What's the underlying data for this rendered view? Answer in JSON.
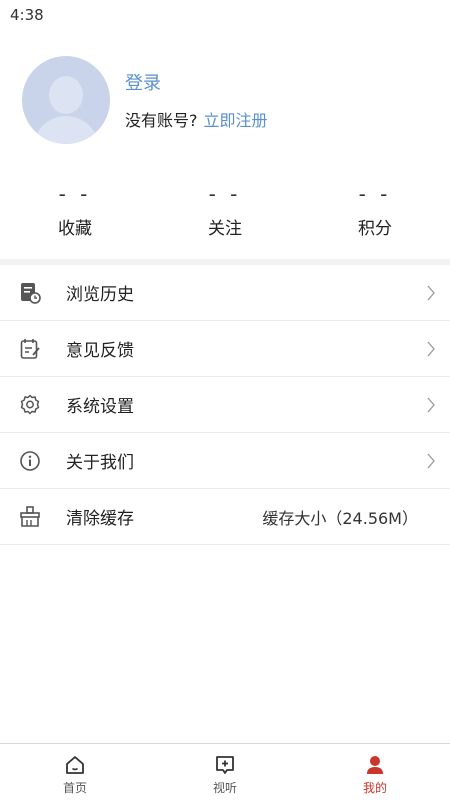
{
  "status_bar": {
    "time": "4:38"
  },
  "profile": {
    "login_label": "登录",
    "no_account_text": "没有账号?",
    "register_link": "立即注册"
  },
  "stats": [
    {
      "value": "- -",
      "label": "收藏"
    },
    {
      "value": "- -",
      "label": "关注"
    },
    {
      "value": "- -",
      "label": "积分"
    }
  ],
  "menu": {
    "items": [
      {
        "label": "浏览历史",
        "icon": "history-icon"
      },
      {
        "label": "意见反馈",
        "icon": "feedback-icon"
      },
      {
        "label": "系统设置",
        "icon": "gear-icon"
      },
      {
        "label": "关于我们",
        "icon": "info-icon"
      },
      {
        "label": "清除缓存",
        "icon": "broom-icon",
        "extra": "缓存大小（24.56M）"
      }
    ]
  },
  "tabbar": {
    "tabs": [
      {
        "label": "首页",
        "icon": "home-icon",
        "active": false
      },
      {
        "label": "视听",
        "icon": "media-icon",
        "active": false
      },
      {
        "label": "我的",
        "icon": "profile-icon",
        "active": true
      }
    ],
    "active_color": "#c8362c"
  },
  "colors": {
    "link": "#5a8fd0",
    "accent": "#c8362c"
  }
}
